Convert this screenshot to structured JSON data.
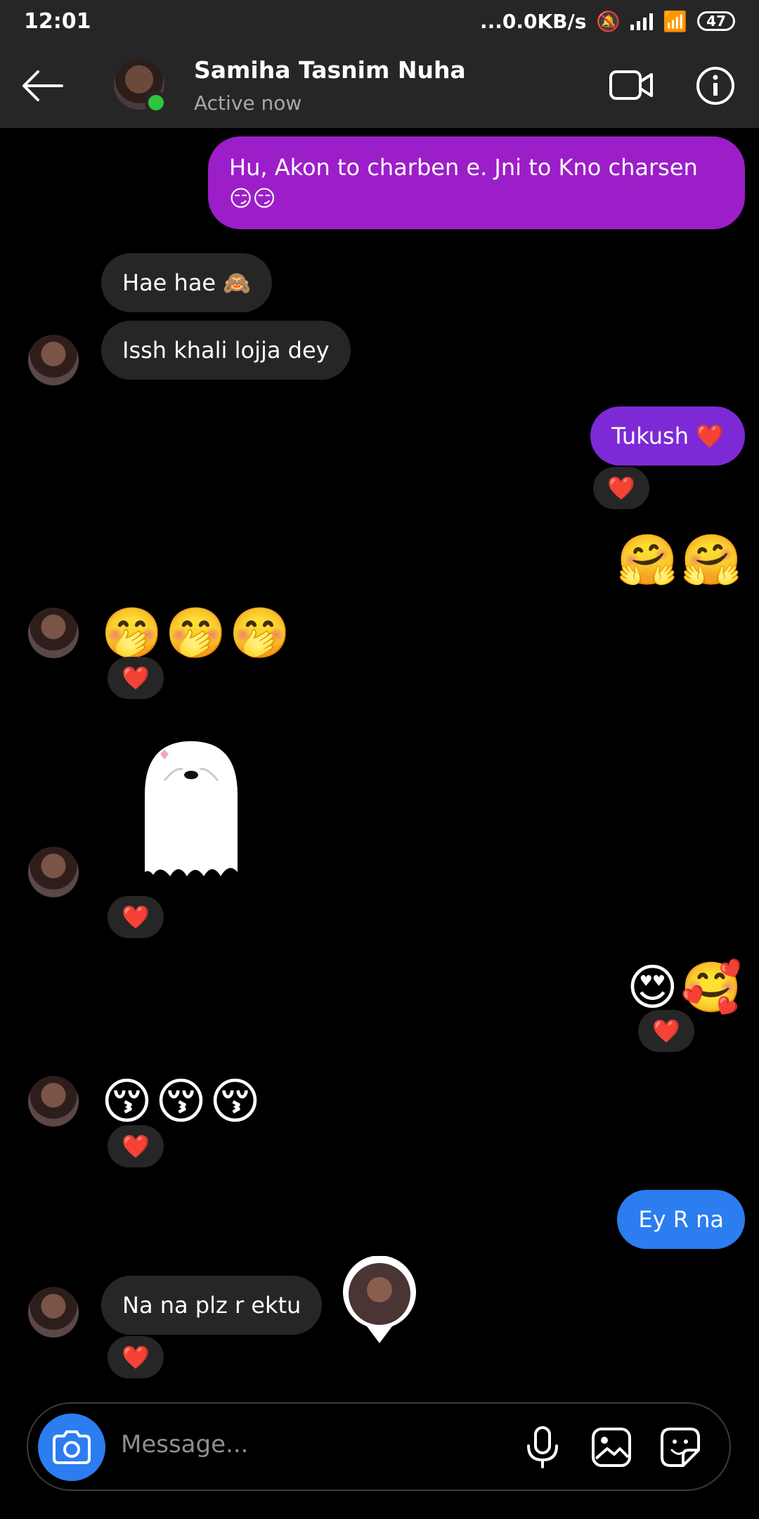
{
  "status_bar": {
    "time": "12:01",
    "network_speed": "...0.0KB/s",
    "battery": "47"
  },
  "header": {
    "contact_name": "Samiha Tasnim Nuha",
    "status": "Active now"
  },
  "messages": [
    {
      "from": "me",
      "text": "Hu, Akon to charben e. Jni to Kno charsen 😏😏"
    },
    {
      "from": "them",
      "text": "Hae hae 🙈"
    },
    {
      "from": "them",
      "text": "Issh khali lojja dey"
    },
    {
      "from": "me",
      "text": "Tukush ❤️",
      "reaction": "❤️"
    },
    {
      "from": "me",
      "text": "🤗🤗"
    },
    {
      "from": "them",
      "text": "🤭🤭🤭",
      "reaction": "❤️"
    },
    {
      "from": "them",
      "sticker": "ghost-sticker",
      "reaction": "❤️"
    },
    {
      "from": "me",
      "text": "😍🥰",
      "reaction": "❤️"
    },
    {
      "from": "them",
      "text": "😚😚😚",
      "reaction": "❤️"
    },
    {
      "from": "me",
      "text": "Ey R na"
    },
    {
      "from": "them",
      "text": "Na na plz r ektu",
      "reaction": "❤️"
    }
  ],
  "composer": {
    "placeholder": "Message..."
  },
  "icons": [
    "back-arrow-icon",
    "video-call-icon",
    "info-icon",
    "camera-icon",
    "microphone-icon",
    "gallery-icon",
    "sticker-icon"
  ],
  "colors": {
    "outgoing_purple": "#9c1ec8",
    "outgoing_violet": "#7d2ad6",
    "outgoing_blue": "#2b7df0",
    "incoming": "#262626",
    "online": "#2ec63c"
  }
}
